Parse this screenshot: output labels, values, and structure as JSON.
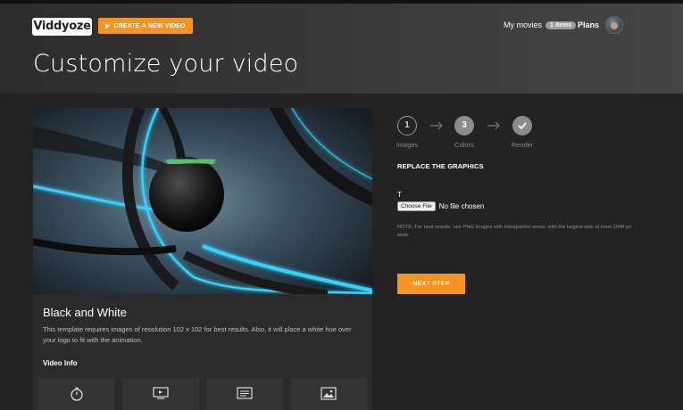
{
  "header": {
    "logo_text": "Viddyoze",
    "create_button": "CREATE A NEW VIDEO",
    "my_movies": "My movies",
    "movies_badge": "1 items",
    "plans": "Plans"
  },
  "page_title": "Customize your video",
  "template": {
    "title": "Black and White",
    "description": "This template requires images of resolution 102 x 102 for best results. Also, it will place a white hue over your logo to fit with the animation.",
    "video_info_label": "Video Info",
    "info_icons": [
      "timer-icon",
      "screen-icon",
      "text-icon",
      "image-icon"
    ]
  },
  "steps": [
    {
      "number": "1",
      "label": "Images",
      "state": "outline"
    },
    {
      "number": "3",
      "label": "Colors",
      "state": "filled"
    },
    {
      "number": "",
      "label": "Render",
      "state": "done"
    }
  ],
  "form": {
    "heading": "REPLACE THE GRAPHICS",
    "field_label": "T",
    "choose_file": "Choose File",
    "no_file": "No file chosen",
    "note": "NOTE: For best results, use PNG images with transparent areas, with the largest side at least 2048 px wide.",
    "next_step": "NEXT STEP"
  },
  "colors": {
    "accent": "#f7941d",
    "background": "#232323",
    "card": "#2b2b2b",
    "glow": "#2fd4ff"
  }
}
